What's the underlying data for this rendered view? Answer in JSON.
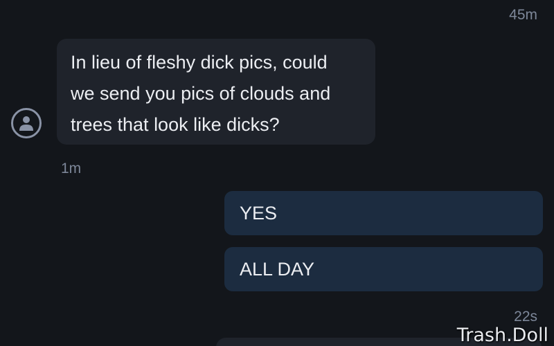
{
  "conversation": {
    "timestamps": {
      "top": "45m",
      "middle": "1m",
      "bottom": "22s"
    },
    "incoming": {
      "avatar_icon": "user-avatar-icon",
      "lines": [
        "In lieu of fleshy dick pics, could",
        "we send you pics of clouds and",
        "trees that look like dicks?"
      ]
    },
    "outgoing": [
      {
        "text": "YES"
      },
      {
        "text": "ALL DAY"
      }
    ]
  },
  "watermark": "Trash.Doll",
  "colors": {
    "background": "#13161b",
    "incoming_bubble": "#1f232b",
    "outgoing_bubble": "#1c2c40",
    "timestamp": "#7d8799",
    "text": "#eceef2"
  }
}
